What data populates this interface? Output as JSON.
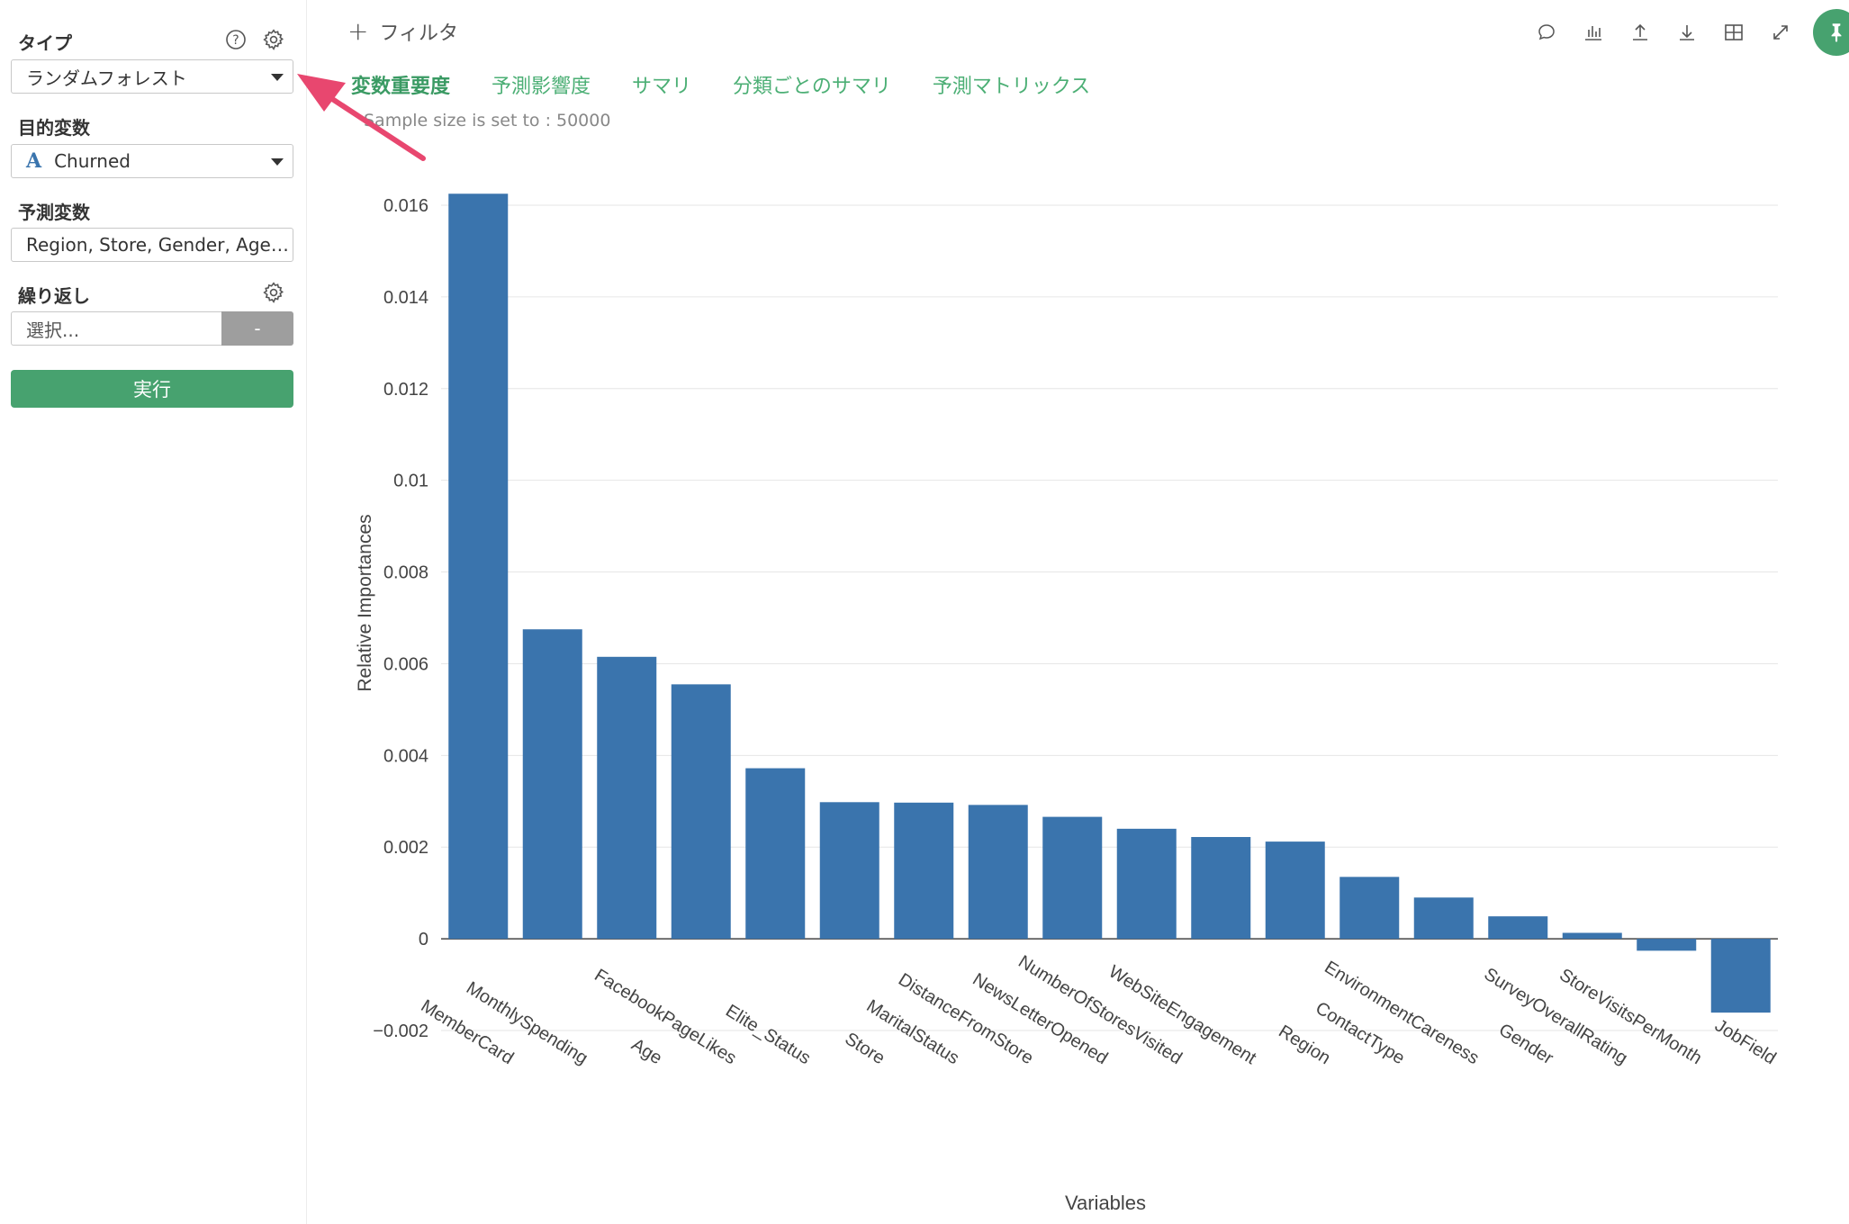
{
  "sidebar": {
    "type_label": "タイプ",
    "type_value": "ランダムフォレスト",
    "target_label": "目的変数",
    "target_type_glyph": "A",
    "target_value": "Churned",
    "predictor_label": "予測変数",
    "predictor_value": "Region, Store, Gender, Age…",
    "repeat_label": "繰り返し",
    "repeat_value": "選択...",
    "repeat_button": "-",
    "run_button": "実行"
  },
  "header": {
    "filter_plus": "+",
    "filter_label": "フィルタ",
    "tabs": [
      "変数重要度",
      "予測影響度",
      "サマリ",
      "分類ごとのサマリ",
      "予測マトリックス"
    ],
    "sample_text": "Sample size is set to : 50000"
  },
  "toolbar_icons": [
    "comment-icon",
    "chart-icon",
    "upload-icon",
    "download-icon",
    "table-icon",
    "expand-icon",
    "pin-icon"
  ],
  "colors": {
    "accent": "#47a26f",
    "bar": "#3a74ad",
    "arrow": "#e8476f"
  },
  "chart_data": {
    "type": "bar",
    "categories": [
      "MemberCard",
      "MonthlySpending",
      "Age",
      "FacebookPageLikes",
      "Elite_Status",
      "Store",
      "MaritalStatus",
      "DistanceFromStore",
      "NewsLetterOpened",
      "NumberOfStoresVisited",
      "WebSiteEngagement",
      "Region",
      "ContactType",
      "EnvironmentCareness",
      "Gender",
      "SurveyOverallRating",
      "StoreVisitsPerMonth",
      "JobField"
    ],
    "values": [
      0.01625,
      0.00675,
      0.00615,
      0.00555,
      0.00372,
      0.00298,
      0.00297,
      0.00292,
      0.00266,
      0.0024,
      0.00222,
      0.00212,
      0.00135,
      0.0009,
      0.00049,
      0.00013,
      -0.00026,
      -0.00161
    ],
    "xlabel": "Variables",
    "ylabel": "Relative Importances",
    "ylim": [
      -0.002,
      0.016
    ],
    "yticks": [
      -0.002,
      0,
      0.002,
      0.004,
      0.006,
      0.008,
      0.01,
      0.012,
      0.014,
      0.016
    ],
    "ytick_labels": [
      "−0.002",
      "0",
      "0.002",
      "0.004",
      "0.006",
      "0.008",
      "0.01",
      "0.012",
      "0.014",
      "0.016"
    ],
    "grid": true
  }
}
